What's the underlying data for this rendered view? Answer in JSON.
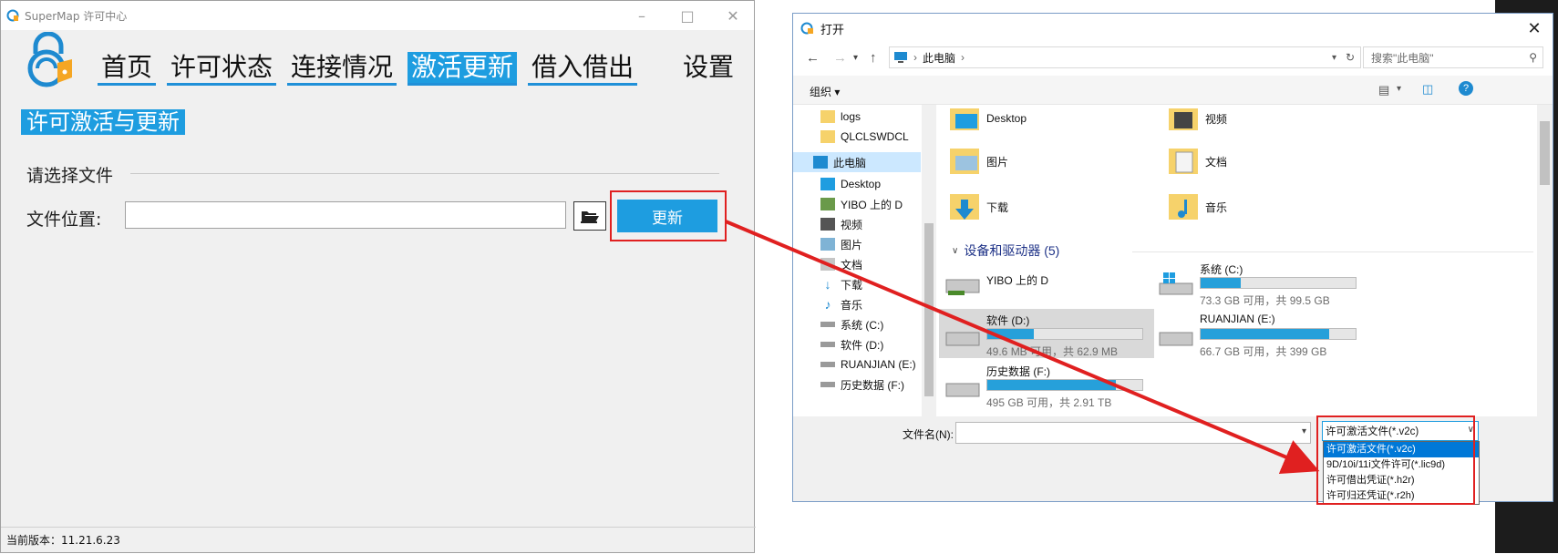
{
  "app": {
    "title": "SuperMap 许可中心",
    "nav": [
      "首页",
      "许可状态",
      "连接情况",
      "激活更新",
      "借入借出"
    ],
    "settings_label": "设置",
    "section_title": "许可激活与更新",
    "group_label": "请选择文件",
    "file_label": "文件位置:",
    "file_value": "",
    "update_button": "更新",
    "version": "当前版本：11.21.6.23"
  },
  "dialog": {
    "title": "打开",
    "breadcrumb": "此电脑",
    "search_placeholder": "搜索\"此电脑\"",
    "organize": "组织 ▾",
    "tree": [
      "logs",
      "QLCLSWDCL",
      "此电脑",
      "Desktop",
      "YIBO 上的 D",
      "视频",
      "图片",
      "文档",
      "下载",
      "音乐",
      "系统 (C:)",
      "软件 (D:)",
      "RUANJIAN (E:)",
      "历史数据 (F:)"
    ],
    "folders": [
      "Desktop",
      "视频",
      "图片",
      "文档",
      "下载",
      "音乐"
    ],
    "devices_header": "设备和驱动器 (5)",
    "drives": [
      {
        "name": "YIBO 上的 D",
        "free": "",
        "used_pct": null
      },
      {
        "name": "系统 (C:)",
        "free": "73.3 GB 可用，共 99.5 GB",
        "used_pct": 26
      },
      {
        "name": "软件 (D:)",
        "free": "49.6 MB 可用，共 62.9 MB",
        "used_pct": 30
      },
      {
        "name": "RUANJIAN (E:)",
        "free": "66.7 GB 可用，共 399 GB",
        "used_pct": 83
      },
      {
        "name": "历史数据 (F:)",
        "free": "495 GB 可用，共 2.91 TB",
        "used_pct": 83
      }
    ],
    "filename_label": "文件名(N):",
    "filename_value": "",
    "filter_selected": "许可激活文件(*.v2c)",
    "filter_options": [
      "许可激活文件(*.v2c)",
      "9D/10i/11i文件许可(*.lic9d)",
      "许可借出凭证(*.h2r)",
      "许可归还凭证(*.r2h)"
    ]
  },
  "colors": {
    "accent": "#1e9de0",
    "highlight_box": "#e02020",
    "selection": "#0078d7"
  }
}
